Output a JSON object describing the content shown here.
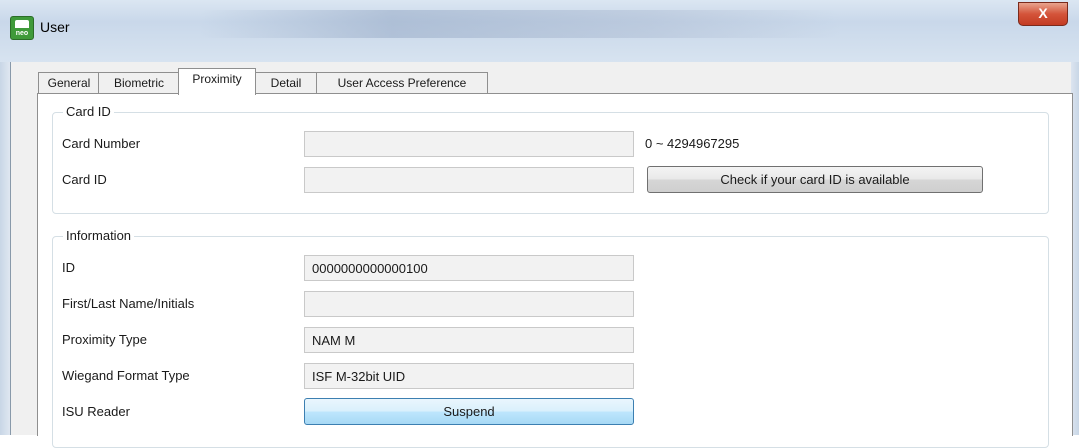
{
  "window": {
    "title": "User",
    "icon_text": "neo",
    "close_glyph": "X",
    "colors": {
      "close_button": "#c33b22",
      "accent_button": "#a7d9f5"
    }
  },
  "tabs": [
    {
      "label": "General",
      "active": false
    },
    {
      "label": "Biometric",
      "active": false
    },
    {
      "label": "Proximity",
      "active": true
    },
    {
      "label": "Detail",
      "active": false
    },
    {
      "label": "User Access Preference",
      "active": false
    }
  ],
  "card_id_group": {
    "legend": "Card ID",
    "card_number_label": "Card Number",
    "card_number_value": "",
    "card_number_range": "0 ~ 4294967295",
    "card_id_label": "Card ID",
    "card_id_value": "",
    "check_button": "Check if your card ID is available"
  },
  "information_group": {
    "legend": "Information",
    "id_label": "ID",
    "id_value": "0000000000000100",
    "name_label": "First/Last Name/Initials",
    "name_value": "",
    "proximity_type_label": "Proximity Type",
    "proximity_type_value": "NAM M",
    "wiegand_label": "Wiegand Format Type",
    "wiegand_value": "ISF M-32bit UID",
    "isu_reader_label": "ISU Reader",
    "suspend_button": "Suspend"
  }
}
